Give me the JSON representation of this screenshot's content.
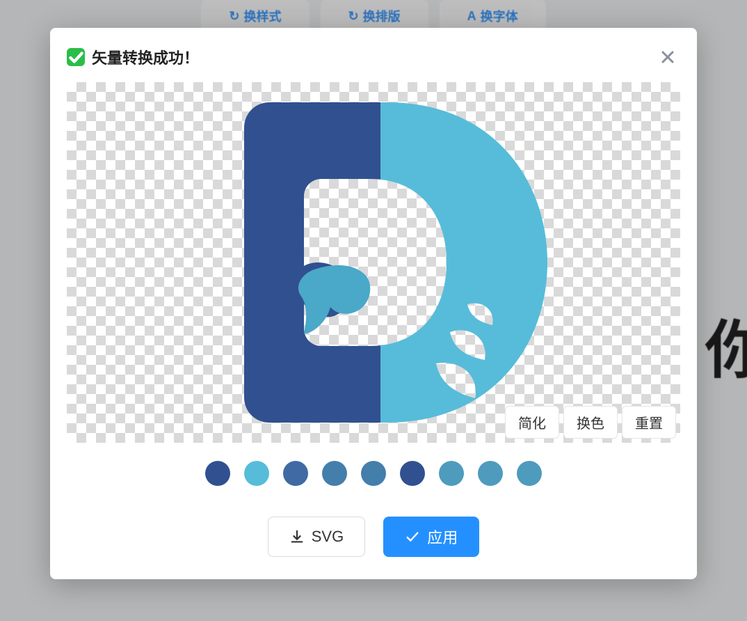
{
  "background": {
    "tabs": [
      "换样式",
      "换排版",
      "换字体"
    ],
    "big_glyph": "你"
  },
  "modal": {
    "title": "矢量转换成功！",
    "preview_actions": {
      "simplify": "简化",
      "recolor": "换色",
      "reset": "重置"
    },
    "swatches": [
      "#31508f",
      "#57bcd9",
      "#3f6aa3",
      "#447eab",
      "#447eab",
      "#31508f",
      "#4f9bbd",
      "#4f9bbd",
      "#4f9bbd"
    ],
    "svg_button": "SVG",
    "apply_button": "应用",
    "logo_colors": {
      "left": "#31508f",
      "right": "#57bcd9"
    }
  }
}
